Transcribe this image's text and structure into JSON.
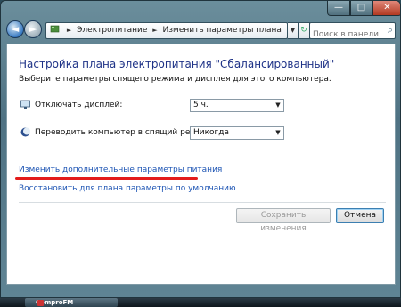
{
  "window": {
    "minimize_glyph": "—",
    "maximize_glyph": "□",
    "close_glyph": "✕"
  },
  "nav": {
    "back_glyph": "◄",
    "forward_glyph": "►",
    "breadcrumbs": [
      "Электропитание",
      "Изменить параметры плана"
    ],
    "search_placeholder": "Поиск в панели у..."
  },
  "content": {
    "heading": "Настройка плана электропитания \"Сбалансированный\"",
    "description": "Выберите параметры спящего режима и дисплея для этого компьютера.",
    "display_label": "Отключать дисплей:",
    "display_value": "5 ч.",
    "sleep_label": "Переводить компьютер в спящий режим:",
    "sleep_value": "Никогда",
    "advanced_link": "Изменить дополнительные параметры питания",
    "restore_link": "Восстановить для плана параметры по умолчанию",
    "save_button": "Сохранить изменения",
    "cancel_button": "Отмена"
  },
  "taskbar": {
    "item_label": "ComproFM"
  },
  "colors": {
    "heading": "#1e3287",
    "link": "#1e55b4",
    "highlight_underline": "#e31b1b"
  }
}
